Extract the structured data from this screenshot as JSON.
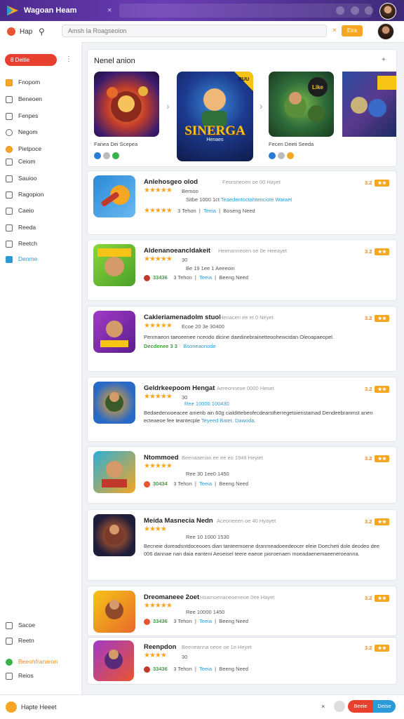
{
  "app": {
    "title": "Wagoan Heam",
    "close": "×"
  },
  "toolbar": {
    "label": "Hap",
    "search_placeholder": "Amsh Ia Roagseoion",
    "close": "×",
    "button": "Eira"
  },
  "sidebar": {
    "pill": "8 Deitie",
    "items": [
      {
        "label": "Fnopom"
      },
      {
        "label": "Beneoen"
      },
      {
        "label": "Fenpes"
      },
      {
        "label": "Negom"
      },
      {
        "label": "Pietpoce"
      },
      {
        "label": "Ceiom"
      },
      {
        "label": "Sauioo"
      },
      {
        "label": "Ragopion"
      },
      {
        "label": "Caeio"
      },
      {
        "label": "Reeda"
      },
      {
        "label": "Reetch"
      },
      {
        "label": "Denme"
      }
    ],
    "bottom": [
      {
        "label": "Sacoe"
      },
      {
        "label": "Reetn"
      },
      {
        "label": "Beeohfranaron"
      },
      {
        "label": "Reios"
      }
    ]
  },
  "featured": {
    "heading": "Nenel anion",
    "more": "+",
    "items": [
      {
        "caption": "Fanea Dei Scepea"
      },
      {
        "banner_title": "SINERGA",
        "banner_subtitle": "Henaes",
        "badge": "BUU"
      },
      {
        "caption": "Fecen Deeti Seeda",
        "badge": "Like"
      }
    ]
  },
  "apps": [
    {
      "name": "Anlehosgeo olod",
      "sub": "Feoroneoen oe 00 Hayet",
      "stars": "★★★★★",
      "line": "Bemoo",
      "rating": "3.2",
      "meta1": "Sitbe 1000 1ct",
      "meta1_rest": "Teaedentoctahtenciote Waraet",
      "meta2_stars": "★★★★★",
      "meta2": "3 Tehon",
      "meta2_b": "Teeia",
      "meta2_c": "Boseng Need"
    },
    {
      "name": "Aldenanoeancldakeit",
      "sub": "Heenanneoen oe 0e Heeayet",
      "stars": "★★★★★",
      "line": "30",
      "rating": "3.2",
      "meta1": "Be 19 1ee 1 Aeeeoin",
      "meta2_green": "33436",
      "meta2": "3 Tehon",
      "meta2_b": "Teeia",
      "meta2_c": "Beeng Need"
    },
    {
      "name": "Cakleriamenadolm stuol",
      "sub": "Henacen ee et 0 Neyet",
      "stars": "★★★★★",
      "line": "Ecoe 20 3e 30400",
      "rating": "3.2",
      "desc": "Penmaeon taeoeenee nceodo dicine daedinebrainetteoohewcidan Oleoapaeopel.",
      "meta_green": "Decdenee 3 3",
      "meta_blue": "Bsoneaonode"
    },
    {
      "name": "Geldrkeepoom Hengat",
      "sub": "Aereonneoe 0000 Henet",
      "stars": "★★★★★",
      "line": "30",
      "rating": "3.2",
      "line2": "Ree 10000 100430",
      "desc": "Bedaedenooeacee amenb ain 60g cialdittebeofecdearstherregetoienstamad Dendeebranmst anen ecteaeoe fee teantecple",
      "desc_blue": "Teyeed Batet. Dawoda."
    },
    {
      "name": "Ntommoed",
      "sub": "Beenaaenan ee ee eo 1949 Heyiet",
      "stars": "★★★★★",
      "line": "Ree 30 1ee0 1450",
      "rating": "3.2",
      "meta2_green": "30434",
      "meta2": "3 Tehon",
      "meta2_b": "Teeia",
      "meta2_c": "Beeng Need"
    },
    {
      "name": "Meida Masnecia Nedn",
      "sub": "Aceoneeen oe 40 Hyayet",
      "stars": "★★★★",
      "line": "Ree 10 1000 1530",
      "rating": "3.2",
      "desc": "Becneie doreadsntdoceooes dian tanteemoene dranmeadoeedeocer eleie Doecheti dole deodeo dee 006 dannae nan daia eanteni Aeoeisel teere eaeoe pioroenaen moeadaenemaeeneroeanna."
    },
    {
      "name": "Dreomaneee 2oet",
      "sub": "Hoamoenaneoeneoe 0ee Hayet",
      "stars": "★★★★★",
      "line": "Ree 10000 1450",
      "rating": "3.2",
      "meta2_green": "33436",
      "meta2": "3 Tehon",
      "meta2_b": "Teeia",
      "meta2_c": "Beeng Need"
    },
    {
      "name": "Reenpdon",
      "sub": "Beeneanna neoe oe 1e Heyet",
      "stars": "★★★★",
      "line": "30",
      "rating": "3.2",
      "meta2_green": "33436",
      "meta2": "3 Tehon",
      "meta2_b": "Teeia",
      "meta2_c": "Beeng Need"
    }
  ],
  "bottombar": {
    "text": "Hapte Heeet",
    "close": "×",
    "btn1": "Beeie",
    "btn2": "Deise"
  }
}
